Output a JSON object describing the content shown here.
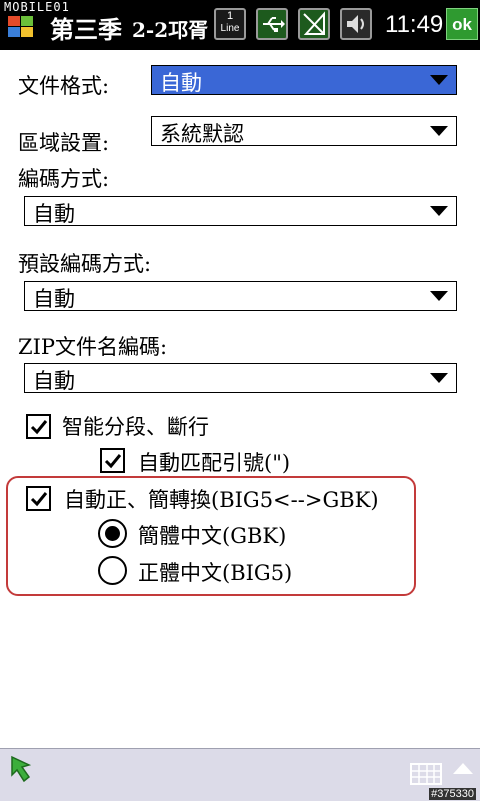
{
  "status_bar": {
    "carrier": "MOBILE01",
    "title_part1": "第三季",
    "title_part2": "2-2邛胥",
    "line_badge_number": "1",
    "line_badge_text": "Line",
    "time": "11:49",
    "ok_label": "ok"
  },
  "form": {
    "file_format": {
      "label": "文件格式:",
      "value": "自動"
    },
    "region": {
      "label": "區域設置:",
      "value": "系統默認"
    },
    "encoding": {
      "label": "編碼方式:",
      "value": "自動"
    },
    "default_encoding": {
      "label": "預設編碼方式:",
      "value": "自動"
    },
    "zip_encoding": {
      "label": "ZIP文件名編碼:",
      "value": "自動"
    },
    "smart_paragraph": {
      "label": "智能分段、斷行",
      "checked": true
    },
    "auto_quotes": {
      "label": "自動匹配引號(\")",
      "checked": true
    },
    "auto_convert": {
      "label": "自動正、簡轉換(BIG5<-->GBK)",
      "checked": true
    },
    "radio_simplified": {
      "label": "簡體中文(GBK)",
      "selected": true
    },
    "radio_traditional": {
      "label": "正體中文(BIG5)",
      "selected": false
    }
  },
  "bottom_bar": {
    "watermark": "#375330"
  },
  "colors": {
    "selected_field": "#3a67d6",
    "highlight_border": "#c33a3a",
    "ok_button": "#2f9a30"
  }
}
